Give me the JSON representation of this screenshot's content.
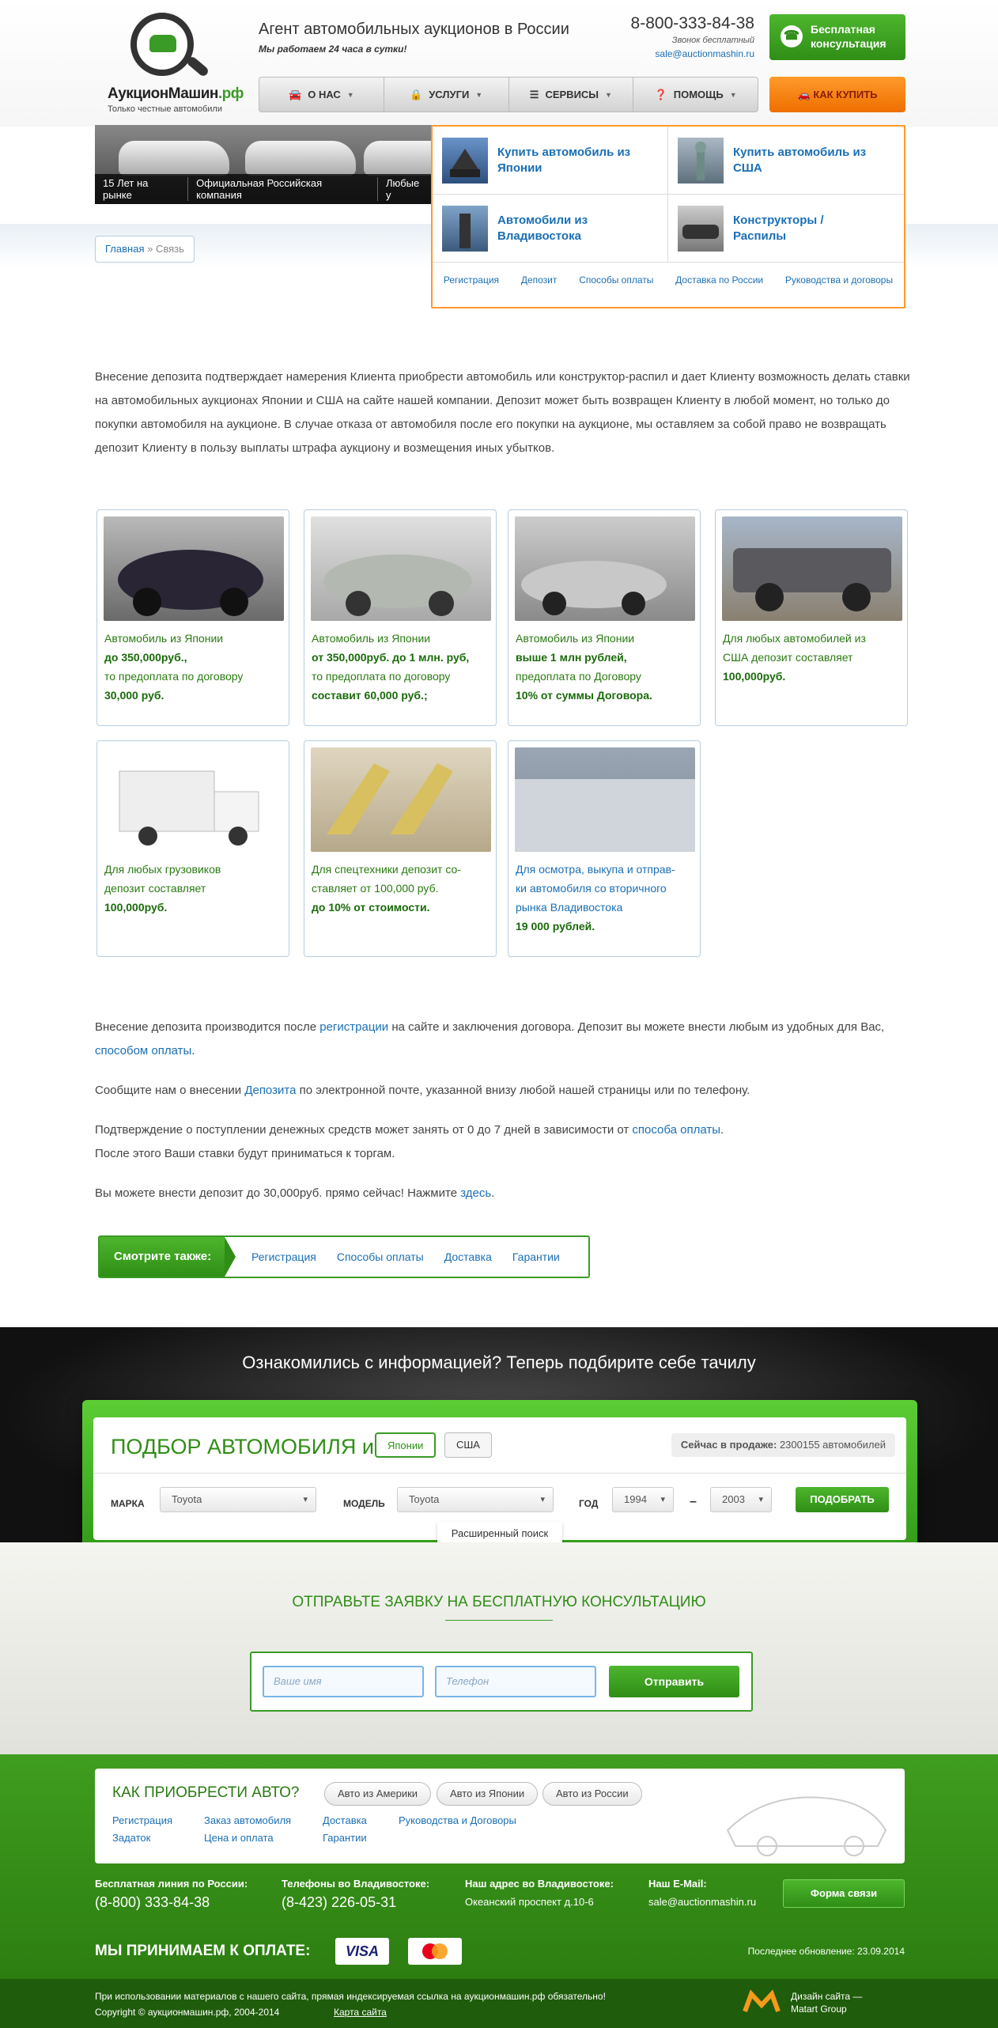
{
  "header": {
    "logo_name_main": "АукционМашин",
    "logo_name_tld": ".рф",
    "logo_sub": "Только честные автомобили",
    "tagline": "Агент автомобильных аукционов в России",
    "worktime": "Мы работаем 24 часа в сутки!",
    "phone": "8-800-333-84-38",
    "phone_note": "Звонок бесплатный",
    "email": "sale@auctionmashin.ru",
    "consult_button": "Бесплатная консультация",
    "buy_button": "КАК КУПИТЬ"
  },
  "menu": [
    {
      "label": "О НАС",
      "icon": "car-icon"
    },
    {
      "label": "УСЛУГИ",
      "icon": "bag-icon"
    },
    {
      "label": "СЕРВИСЫ",
      "icon": "list-icon"
    },
    {
      "label": "ПОМОЩЬ",
      "icon": "help-icon"
    }
  ],
  "banner": [
    "15 Лет на рынке",
    "Официальная Российская компания",
    "Любые у"
  ],
  "breadcrumb": {
    "home": "Главная",
    "sep": "»",
    "current": "Связь"
  },
  "dropdown": {
    "items": [
      {
        "label": "Купить автомобиль из Японии"
      },
      {
        "label": "Купить автомобиль из США"
      },
      {
        "label": "Автомобили из Владивостока"
      },
      {
        "label": "Конструкторы / Распилы"
      }
    ],
    "links": [
      "Регистрация",
      "Депозит",
      "Способы оплаты",
      "Доставка по России",
      "Руководства и договоры"
    ]
  },
  "intro": "Внесение депозита подтверждает намерения Клиента приобрести автомобиль или конструктор-распил и дает Клиенту возможность делать ставки на автомобильных аукционах Японии и США на сайте нашей компании. Депозит может быть возвращен Клиенту в любой момент, но только до покупки автомобиля на аукционе. В случае отказа от автомобиля после его покупки на аукционе, мы оставляем за собой право не возвращать депозит Клиенту в пользу выплаты штрафа аукциону и возмещения иных убытков.",
  "cards": [
    {
      "l1": "Автомобиль из Японии",
      "l2": "до 350,000руб.,",
      "l3": "то предоплата по договору",
      "l4": "30,000 руб."
    },
    {
      "l1": "Автомобиль из Японии",
      "l2": "от 350,000руб. до 1 млн. руб,",
      "l3": "то предоплата по договору",
      "l4": "составит 60,000 руб.;"
    },
    {
      "l1": "Автомобиль из Японии",
      "l2": "выше 1 млн рублей,",
      "l3": "предоплата по Договору",
      "l4": "10% от суммы Договора."
    },
    {
      "l1": "Для любых автомобилей из",
      "l2": "США депозит составляет",
      "l3": "100,000руб.",
      "l4": ""
    },
    {
      "l1": "Для любых грузовиков",
      "l2": "депозит составляет",
      "l3": "100,000руб.",
      "l4": ""
    },
    {
      "l1": "Для спецтехники депозит со-",
      "l2": "ставляет от 100,000 руб.",
      "l3": "до 10% от стоимости.",
      "l4": ""
    },
    {
      "l1": "Для осмотра, выкупа и отправ-",
      "l2": "ки автомобиля со вторичного",
      "l3": "рынка Владивостока",
      "l4": "19 000 рублей."
    }
  ],
  "body": {
    "p1a": "Внесение депозита производится после ",
    "p1_link1": "регистрации",
    "p1b": " на сайте и заключения договора. Депозит вы можете внести любым из удобных для Вас, ",
    "p1_link2": "способом оплаты",
    "p1c": ".",
    "p2a": "Сообщите нам о внесении ",
    "p2_link": "Депозита",
    "p2b": " по электронной почте, указанной внизу любой нашей страницы или по телефону.",
    "p3a": "Подтверждение о поступлении денежных средств может занять от 0 до 7 дней в зависимости от ",
    "p3_link": "способа оплаты",
    "p3b": ".",
    "p3c": "После этого Ваши ставки будут приниматься к торгам.",
    "p4a": "Вы можете внести депозит до 30,000руб. прямо сейчас! Нажмите ",
    "p4_link": "здесь",
    "p4b": "."
  },
  "seealso": {
    "title": "Смотрите также:",
    "links": [
      "Регистрация",
      "Способы оплаты",
      "Доставка",
      "Гарантии"
    ]
  },
  "picker": {
    "headline": "Ознакомились с информацией? Теперь подбирите себе тачилу",
    "title": "ПОДБОР АВТОМОБИЛЯ из",
    "tab_japan": "Японии",
    "tab_usa": "США",
    "onsale_label": "Сейчас в продаже:",
    "onsale_value": "2300155 автомобилей",
    "make_label": "МАРКА",
    "make_value": "Toyota",
    "model_label": "МОДЕЛЬ",
    "model_value": "Toyota",
    "year_label": "ГОД",
    "year_from": "1994",
    "dash": "–",
    "year_to": "2003",
    "submit": "ПОДОБРАТЬ",
    "extended": "Расширенный поиск"
  },
  "consult": {
    "title": "ОТПРАВЬТЕ ЗАЯВКУ НА БЕСПЛАТНУЮ КОНСУЛЬТАЦИЮ",
    "name_placeholder": "Ваше имя",
    "phone_placeholder": "Телефон",
    "submit": "Отправить"
  },
  "footer": {
    "howbuy_title": "КАК ПРИОБРЕСТИ АВТО?",
    "pills": [
      "Авто из Америки",
      "Авто из Японии",
      "Авто из России"
    ],
    "links": [
      "Регистрация",
      "Задаток",
      "Заказ автомобиля",
      "Цена и оплата",
      "Доставка",
      "Гарантии",
      "Руководства и Договоры"
    ],
    "cols": [
      {
        "head": "Бесплатная линия по России:",
        "value": "(8-800) 333-84-38"
      },
      {
        "head": "Телефоны во Владивостоке:",
        "value": "(8-423) 226-05-31"
      },
      {
        "head": "Наш адрес во Владивостоке:",
        "value": "Океанский проспект д.10-6"
      },
      {
        "head": "Наш E-Mail:",
        "value": "sale@auctionmashin.ru"
      }
    ],
    "form_button": "Форма связи",
    "pay_label": "МЫ ПРИНИМАЕМ К ОПЛАТЕ:",
    "visa": "VISA",
    "updated": "Последнее обновление: 23.09.2014",
    "notice": "При использовании материалов с нашего сайта, прямая индексируемая ссылка на аукционмашин.рф обязательно!",
    "copyright": "Copyright © аукционмашин.рф, 2004-2014",
    "sitemap": "Карта сайта",
    "design_line1": "Дизайн сайта —",
    "design_line2": "Matart Group"
  },
  "colors": {
    "accent_green": "#3a9b26",
    "accent_orange": "#ee6f00",
    "link_blue": "#1b6fb5"
  }
}
